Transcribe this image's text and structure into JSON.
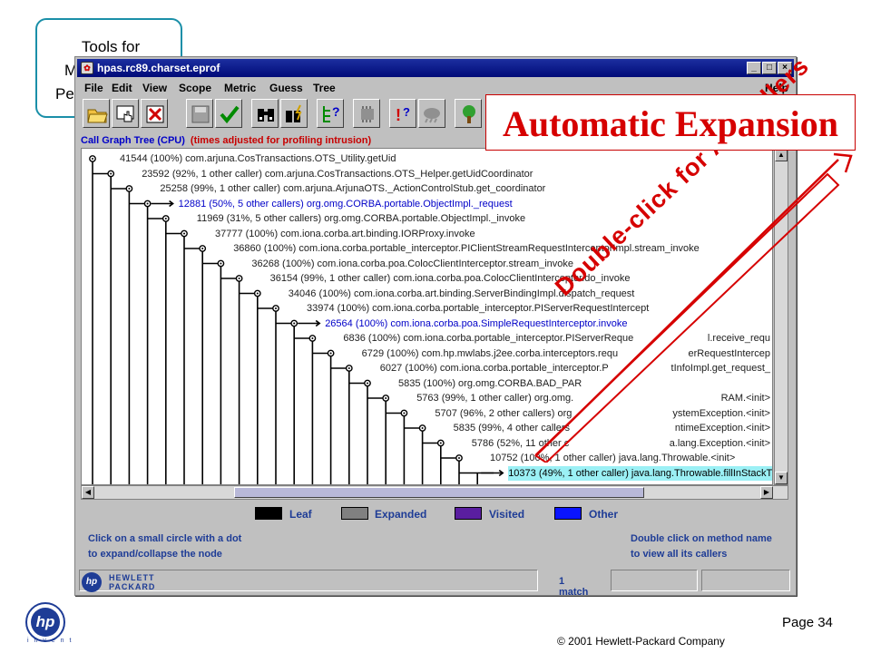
{
  "slide": {
    "title_fragments": [
      "Tools for",
      "M",
      "Pe"
    ],
    "page_number": "Page 34",
    "copyright": "© 2001 Hewlett-Packard  Company",
    "logo_text": "hp",
    "logo_tagline": "i n v e n t"
  },
  "window": {
    "title": "hpas.rc89.charset.eprof",
    "controls": [
      "_",
      "□",
      "×"
    ]
  },
  "menu": {
    "items": [
      "File",
      "Edit",
      "View",
      "Scope",
      "Metric",
      "Guess",
      "Tree"
    ],
    "help": "Help"
  },
  "toolbar": {
    "icons": [
      "open-folder-icon",
      "hand-pointer-icon",
      "close-file-icon",
      "save-disk-icon",
      "checkmark-icon",
      "binoculars-icon",
      "binoculars-lightning-icon",
      "tree-question-icon",
      "chip-icon",
      "alert-question-icon",
      "cloud-question-icon",
      "tree-branch-icon"
    ]
  },
  "tree": {
    "header_title": "Call Graph Tree (CPU)",
    "header_note": "(times adjusted for profiling intrusion)",
    "rows": [
      {
        "text": "41544 (100%) com.arjuna.CosTransactions.OTS_Utility.getUid",
        "style": "normal"
      },
      {
        "text": "23592 (92%, 1 other caller) com.arjuna.CosTransactions.OTS_Helper.getUidCoordinator",
        "style": "normal"
      },
      {
        "text": "25258 (99%, 1 other caller) com.arjuna.ArjunaOTS._ActionControlStub.get_coordinator",
        "style": "normal"
      },
      {
        "text": "12881 (50%, 5 other callers) org.omg.CORBA.portable.ObjectImpl._request",
        "style": "blue"
      },
      {
        "text": "11969 (31%, 5 other callers) org.omg.CORBA.portable.ObjectImpl._invoke",
        "style": "normal"
      },
      {
        "text": "37777 (100%) com.iona.corba.art.binding.IORProxy.invoke",
        "style": "normal"
      },
      {
        "text": "36860 (100%) com.iona.corba.portable_interceptor.PIClientStreamRequestInterceptorImpl.stream_invoke",
        "style": "normal"
      },
      {
        "text": "36268 (100%) com.iona.corba.poa.ColocClientInterceptor.stream_invoke",
        "style": "normal"
      },
      {
        "text": "36154 (99%, 1 other caller) com.iona.corba.poa.ColocClientInterceptor.do_invoke",
        "style": "normal"
      },
      {
        "text": "34046 (100%) com.iona.corba.art.binding.ServerBindingImpl.dispatch_request",
        "style": "normal"
      },
      {
        "text": "33974 (100%) com.iona.corba.portable_interceptor.PIServerRequestIntercept",
        "style": "normal"
      },
      {
        "text": "26564 (100%) com.iona.corba.poa.SimpleRequestInterceptor.invoke",
        "style": "blue"
      },
      {
        "text": "6836 (100%) com.iona.corba.portable_interceptor.PIServerReque",
        "style": "normal"
      },
      {
        "text": "6729 (100%) com.hp.mwlabs.j2ee.corba.interceptors.requ",
        "style": "normal"
      },
      {
        "text": "6027 (100%) com.iona.corba.portable_interceptor.P",
        "style": "normal"
      },
      {
        "text": "5835 (100%) org.omg.CORBA.BAD_PAR",
        "style": "normal"
      },
      {
        "text": "5763 (99%, 1 other caller) org.omg.",
        "style": "normal"
      },
      {
        "text": "5707 (96%, 2 other callers) org",
        "style": "normal"
      },
      {
        "text": "5835 (99%, 4 other callers",
        "style": "normal"
      },
      {
        "text": "5786 (52%, 11 other c",
        "style": "normal"
      },
      {
        "text": "10752 (100%, 1 other caller) java.lang.Throwable.<init>",
        "style": "normal"
      },
      {
        "text": "10373 (49%, 1 other caller) java.lang.Throwable.fillInStackTrace",
        "style": "selected"
      }
    ],
    "right_fragments": [
      {
        "row": 12,
        "text": "l.receive_requ"
      },
      {
        "row": 13,
        "text": "erRequestIntercep"
      },
      {
        "row": 14,
        "text": "tInfoImpl.get_request_"
      },
      {
        "row": 16,
        "text": "RAM.<init>"
      },
      {
        "row": 17,
        "text": "ystemException.<init>"
      },
      {
        "row": 18,
        "text": "ntimeException.<init>"
      },
      {
        "row": 19,
        "text": "a.lang.Exception.<init>"
      }
    ]
  },
  "legend": [
    {
      "label": "Leaf",
      "color": "#000000"
    },
    {
      "label": "Expanded",
      "color": "#808080"
    },
    {
      "label": "Visited",
      "color": "#5a1ea0"
    },
    {
      "label": "Other",
      "color": "#0a14ff"
    }
  ],
  "hints": {
    "left_line1": "Click on a small circle with a dot",
    "left_line2": "to expand/collapse the node",
    "right_line1": "Double click on method name",
    "right_line2": "to view all its callers"
  },
  "statusbar": {
    "brand_line1": "HEWLETT",
    "brand_line2": "PACKARD",
    "brand_badge": "hp",
    "match_count": "1 match"
  },
  "callouts": {
    "headline": "Automatic Expansion",
    "diagonal": "Double-click for All Callers",
    "accent_color": "#d60000"
  }
}
